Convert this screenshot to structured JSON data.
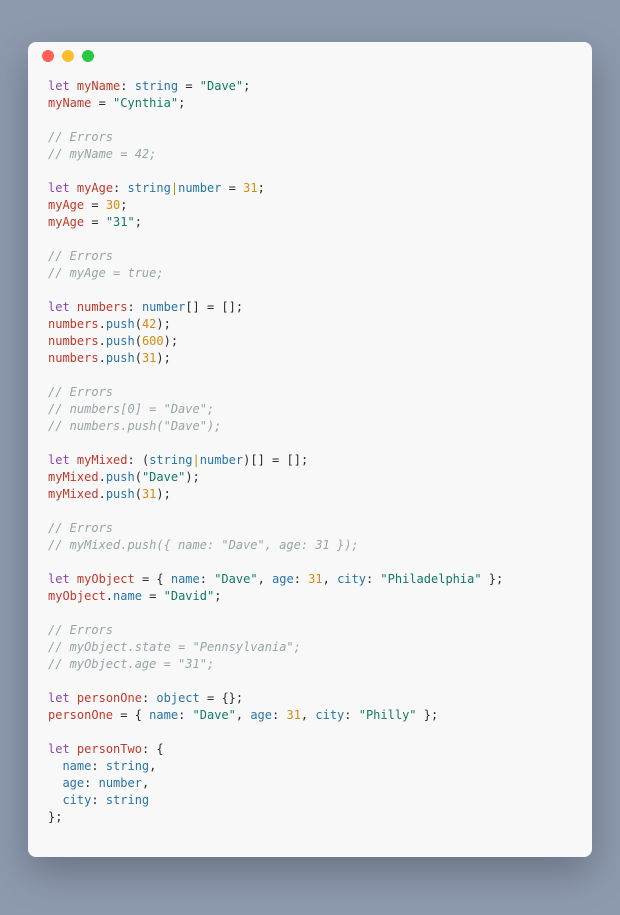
{
  "window": {
    "titlebar": [
      "close",
      "minimize",
      "maximize"
    ]
  },
  "code": [
    [
      [
        "kw",
        "let"
      ],
      [
        "pun",
        " "
      ],
      [
        "var",
        "myName"
      ],
      [
        "pun",
        ": "
      ],
      [
        "type",
        "string"
      ],
      [
        "pun",
        " = "
      ],
      [
        "str",
        "\"Dave\""
      ],
      [
        "pun",
        ";"
      ]
    ],
    [
      [
        "var",
        "myName"
      ],
      [
        "pun",
        " = "
      ],
      [
        "str",
        "\"Cynthia\""
      ],
      [
        "pun",
        ";"
      ]
    ],
    "blank",
    [
      [
        "com",
        "// Errors"
      ]
    ],
    [
      [
        "com",
        "// myName = 42;"
      ]
    ],
    "blank",
    [
      [
        "kw",
        "let"
      ],
      [
        "pun",
        " "
      ],
      [
        "var",
        "myAge"
      ],
      [
        "pun",
        ": "
      ],
      [
        "type",
        "string"
      ],
      [
        "op",
        "|"
      ],
      [
        "type",
        "number"
      ],
      [
        "pun",
        " = "
      ],
      [
        "num",
        "31"
      ],
      [
        "pun",
        ";"
      ]
    ],
    [
      [
        "var",
        "myAge"
      ],
      [
        "pun",
        " = "
      ],
      [
        "num",
        "30"
      ],
      [
        "pun",
        ";"
      ]
    ],
    [
      [
        "var",
        "myAge"
      ],
      [
        "pun",
        " = "
      ],
      [
        "str",
        "\"31\""
      ],
      [
        "pun",
        ";"
      ]
    ],
    "blank",
    [
      [
        "com",
        "// Errors"
      ]
    ],
    [
      [
        "com",
        "// myAge = true;"
      ]
    ],
    "blank",
    [
      [
        "kw",
        "let"
      ],
      [
        "pun",
        " "
      ],
      [
        "var",
        "numbers"
      ],
      [
        "pun",
        ": "
      ],
      [
        "type",
        "number"
      ],
      [
        "pun",
        "[] = [];"
      ]
    ],
    [
      [
        "var",
        "numbers"
      ],
      [
        "pun",
        "."
      ],
      [
        "call",
        "push"
      ],
      [
        "pun",
        "("
      ],
      [
        "num",
        "42"
      ],
      [
        "pun",
        ");"
      ]
    ],
    [
      [
        "var",
        "numbers"
      ],
      [
        "pun",
        "."
      ],
      [
        "call",
        "push"
      ],
      [
        "pun",
        "("
      ],
      [
        "num",
        "600"
      ],
      [
        "pun",
        ");"
      ]
    ],
    [
      [
        "var",
        "numbers"
      ],
      [
        "pun",
        "."
      ],
      [
        "call",
        "push"
      ],
      [
        "pun",
        "("
      ],
      [
        "num",
        "31"
      ],
      [
        "pun",
        ");"
      ]
    ],
    "blank",
    [
      [
        "com",
        "// Errors"
      ]
    ],
    [
      [
        "com",
        "// numbers[0] = \"Dave\";"
      ]
    ],
    [
      [
        "com",
        "// numbers.push(\"Dave\");"
      ]
    ],
    "blank",
    [
      [
        "kw",
        "let"
      ],
      [
        "pun",
        " "
      ],
      [
        "var",
        "myMixed"
      ],
      [
        "pun",
        ": ("
      ],
      [
        "type",
        "string"
      ],
      [
        "op",
        "|"
      ],
      [
        "type",
        "number"
      ],
      [
        "pun",
        ")[] = [];"
      ]
    ],
    [
      [
        "var",
        "myMixed"
      ],
      [
        "pun",
        "."
      ],
      [
        "call",
        "push"
      ],
      [
        "pun",
        "("
      ],
      [
        "str",
        "\"Dave\""
      ],
      [
        "pun",
        ");"
      ]
    ],
    [
      [
        "var",
        "myMixed"
      ],
      [
        "pun",
        "."
      ],
      [
        "call",
        "push"
      ],
      [
        "pun",
        "("
      ],
      [
        "num",
        "31"
      ],
      [
        "pun",
        ");"
      ]
    ],
    "blank",
    [
      [
        "com",
        "// Errors"
      ]
    ],
    [
      [
        "com",
        "// myMixed.push({ name: \"Dave\", age: 31 });"
      ]
    ],
    "blank",
    [
      [
        "kw",
        "let"
      ],
      [
        "pun",
        " "
      ],
      [
        "var",
        "myObject"
      ],
      [
        "pun",
        " = { "
      ],
      [
        "prop",
        "name"
      ],
      [
        "pun",
        ": "
      ],
      [
        "str",
        "\"Dave\""
      ],
      [
        "pun",
        ", "
      ],
      [
        "prop",
        "age"
      ],
      [
        "pun",
        ": "
      ],
      [
        "num",
        "31"
      ],
      [
        "pun",
        ", "
      ],
      [
        "prop",
        "city"
      ],
      [
        "pun",
        ": "
      ],
      [
        "str",
        "\"Philadelphia\""
      ],
      [
        "pun",
        " };"
      ]
    ],
    [
      [
        "var",
        "myObject"
      ],
      [
        "pun",
        "."
      ],
      [
        "prop",
        "name"
      ],
      [
        "pun",
        " = "
      ],
      [
        "str",
        "\"David\""
      ],
      [
        "pun",
        ";"
      ]
    ],
    "blank",
    [
      [
        "com",
        "// Errors"
      ]
    ],
    [
      [
        "com",
        "// myObject.state = \"Pennsylvania\";"
      ]
    ],
    [
      [
        "com",
        "// myObject.age = \"31\";"
      ]
    ],
    "blank",
    [
      [
        "kw",
        "let"
      ],
      [
        "pun",
        " "
      ],
      [
        "var",
        "personOne"
      ],
      [
        "pun",
        ": "
      ],
      [
        "type",
        "object"
      ],
      [
        "pun",
        " = {};"
      ]
    ],
    [
      [
        "var",
        "personOne"
      ],
      [
        "pun",
        " = { "
      ],
      [
        "prop",
        "name"
      ],
      [
        "pun",
        ": "
      ],
      [
        "str",
        "\"Dave\""
      ],
      [
        "pun",
        ", "
      ],
      [
        "prop",
        "age"
      ],
      [
        "pun",
        ": "
      ],
      [
        "num",
        "31"
      ],
      [
        "pun",
        ", "
      ],
      [
        "prop",
        "city"
      ],
      [
        "pun",
        ": "
      ],
      [
        "str",
        "\"Philly\""
      ],
      [
        "pun",
        " };"
      ]
    ],
    "blank",
    [
      [
        "kw",
        "let"
      ],
      [
        "pun",
        " "
      ],
      [
        "var",
        "personTwo"
      ],
      [
        "pun",
        ": {"
      ]
    ],
    [
      [
        "pun",
        "  "
      ],
      [
        "prop",
        "name"
      ],
      [
        "pun",
        ": "
      ],
      [
        "type",
        "string"
      ],
      [
        "pun",
        ","
      ]
    ],
    [
      [
        "pun",
        "  "
      ],
      [
        "prop",
        "age"
      ],
      [
        "pun",
        ": "
      ],
      [
        "type",
        "number"
      ],
      [
        "pun",
        ","
      ]
    ],
    [
      [
        "pun",
        "  "
      ],
      [
        "prop",
        "city"
      ],
      [
        "pun",
        ": "
      ],
      [
        "type",
        "string"
      ]
    ],
    [
      [
        "pun",
        "};"
      ]
    ]
  ]
}
